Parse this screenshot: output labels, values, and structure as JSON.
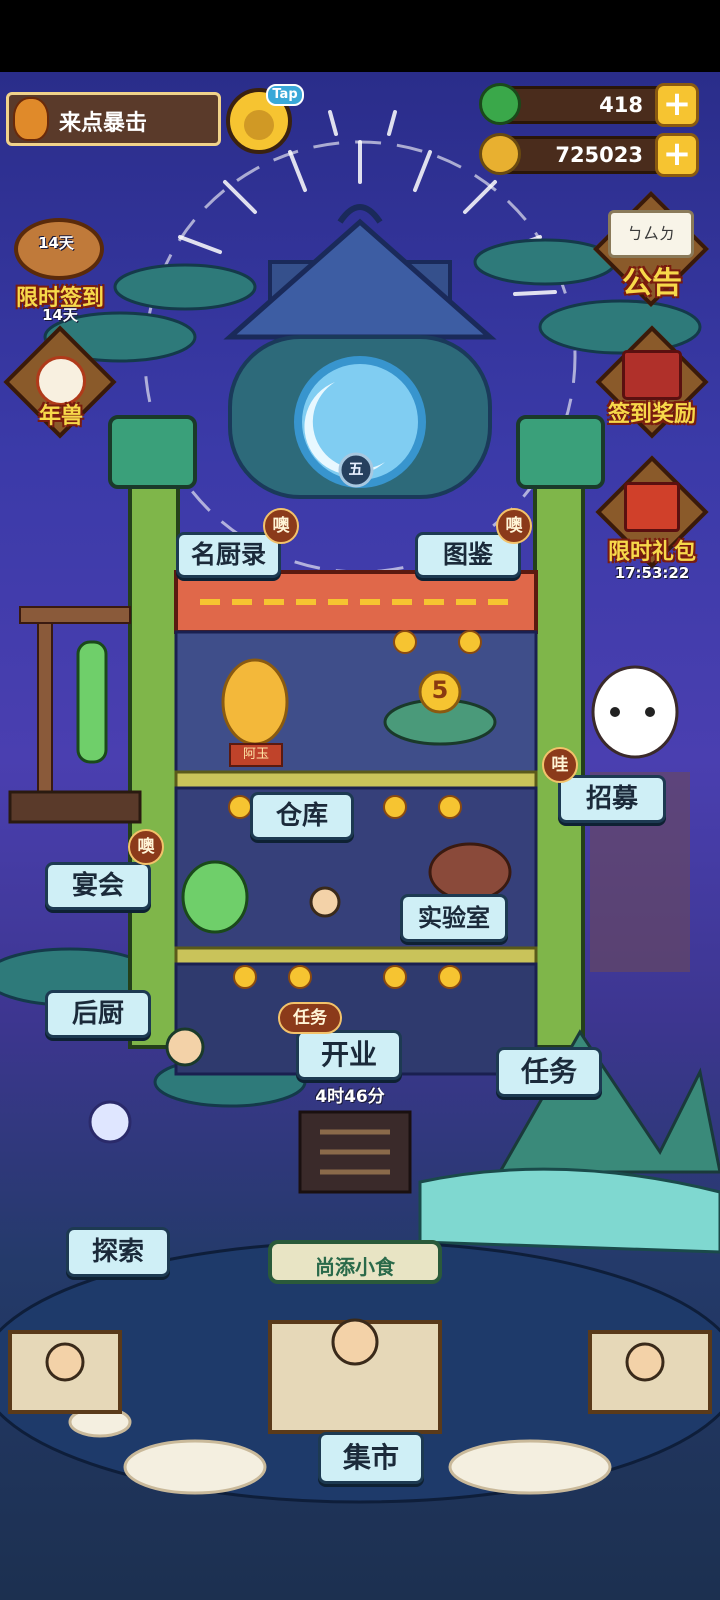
{
  "topbar": {
    "event_label": "来点暴击",
    "tap_label": "Tap",
    "resources": [
      {
        "name": "jade",
        "value": "418",
        "icon": "jade-icon",
        "color": "#3aa84a"
      },
      {
        "name": "coin",
        "value": "725023",
        "icon": "coin-icon",
        "color": "#e8b030"
      }
    ]
  },
  "left_side": {
    "signin": {
      "label": "限时签到",
      "sub": "14天"
    },
    "nianshou": {
      "label": "年兽"
    }
  },
  "right_side": {
    "notice": {
      "label": "公告",
      "scroll_text": "ㄅㄙㄉ"
    },
    "signin_reward": {
      "label": "签到奖励"
    },
    "gift": {
      "label": "限时礼包",
      "timer": "17:53:22"
    }
  },
  "building": {
    "plaque": "五",
    "sign_statue": "阿玉",
    "cake_number": "5"
  },
  "buttons": {
    "chefs": {
      "label": "名厨录",
      "badge": "噢"
    },
    "atlas": {
      "label": "图鉴",
      "badge": "噢"
    },
    "warehouse": {
      "label": "仓库"
    },
    "recruit": {
      "label": "招募",
      "badge": "哇"
    },
    "banquet": {
      "label": "宴会",
      "badge": "噢"
    },
    "lab": {
      "label": "实验室"
    },
    "kitchen": {
      "label": "后厨"
    },
    "open": {
      "label": "开业",
      "badge": "任务",
      "timer": "4时46分"
    },
    "tasks": {
      "label": "任务"
    },
    "explore": {
      "label": "探索"
    },
    "market": {
      "label": "集市"
    }
  },
  "market_sign": "尚添小食",
  "colors": {
    "label_bg": "#cfeff6",
    "label_border": "#1d3a52",
    "badge_bg": "#8b3a1a",
    "side_text": "#f7d94a",
    "sky": "#3b3aa8"
  }
}
